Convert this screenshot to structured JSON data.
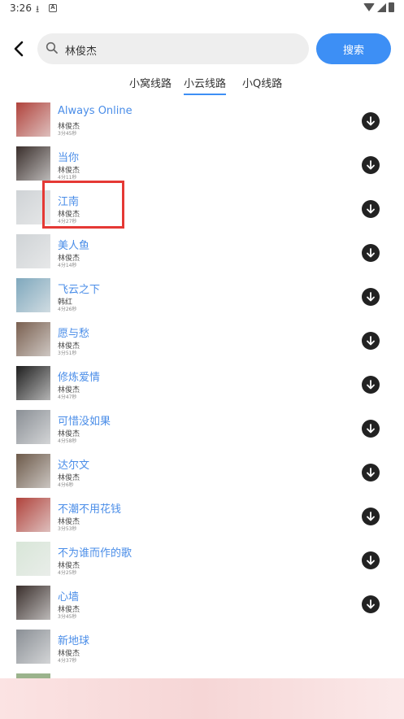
{
  "status_bar": {
    "time": "3:26"
  },
  "header": {
    "search_value": "林俊杰",
    "search_button": "搜索"
  },
  "tabs": [
    {
      "label": "小窝线路",
      "active": false
    },
    {
      "label": "小云线路",
      "active": true
    },
    {
      "label": "小Q线路",
      "active": false
    }
  ],
  "songs": [
    {
      "title": "Always Online",
      "artist": "林俊杰",
      "duration": "3分45秒",
      "cover_color": "#b0433c"
    },
    {
      "title": "当你",
      "artist": "林俊杰",
      "duration": "4分11秒",
      "cover_color": "#3a2f2c"
    },
    {
      "title": "江南",
      "artist": "林俊杰",
      "duration": "4分27秒",
      "cover_color": "#cfd3d6"
    },
    {
      "title": "美人鱼",
      "artist": "林俊杰",
      "duration": "4分14秒",
      "cover_color": "#cfd3d6"
    },
    {
      "title": "飞云之下",
      "artist": "韩红",
      "duration": "4分26秒",
      "cover_color": "#7fa8bd"
    },
    {
      "title": "愿与愁",
      "artist": "林俊杰",
      "duration": "3分51秒",
      "cover_color": "#7a6050"
    },
    {
      "title": "修炼爱情",
      "artist": "林俊杰",
      "duration": "4分47秒",
      "cover_color": "#1f1f1f"
    },
    {
      "title": "可惜没如果",
      "artist": "林俊杰",
      "duration": "4分58秒",
      "cover_color": "#8a8f95"
    },
    {
      "title": "达尔文",
      "artist": "林俊杰",
      "duration": "4分6秒",
      "cover_color": "#6d5a4a"
    },
    {
      "title": "不潮不用花钱",
      "artist": "林俊杰",
      "duration": "3分53秒",
      "cover_color": "#b0433c"
    },
    {
      "title": "不为谁而作的歌",
      "artist": "林俊杰",
      "duration": "4分25秒",
      "cover_color": "#d8e6d8"
    },
    {
      "title": "心墙",
      "artist": "林俊杰",
      "duration": "3分45秒",
      "cover_color": "#3a2f2c"
    },
    {
      "title": "新地球",
      "artist": "林俊杰",
      "duration": "4分37秒",
      "cover_color": "#8a8f95"
    }
  ],
  "highlighted_song_index": 2,
  "colors": {
    "accent": "#3d8ff5",
    "title": "#4a8de8",
    "highlight": "#e53935"
  }
}
